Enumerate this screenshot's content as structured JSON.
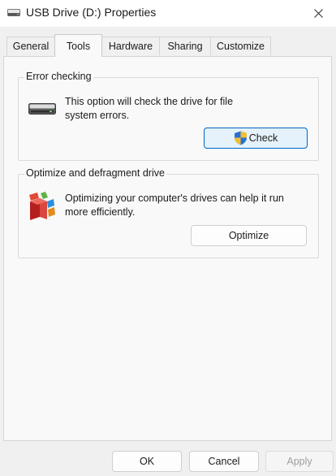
{
  "window": {
    "title": "USB Drive (D:) Properties"
  },
  "tabs": [
    {
      "label": "General"
    },
    {
      "label": "Tools",
      "active": true
    },
    {
      "label": "Hardware"
    },
    {
      "label": "Sharing"
    },
    {
      "label": "Customize"
    }
  ],
  "error_checking": {
    "title": "Error checking",
    "description_line1": "This option will check the drive for file",
    "description_line2": "system errors.",
    "button_label": "Check",
    "icon": "drive-icon"
  },
  "optimize": {
    "title": "Optimize and defragment drive",
    "description_line1": "Optimizing your computer's drives can help it run",
    "description_line2": "more efficiently.",
    "button_label": "Optimize",
    "icon": "defrag-icon"
  },
  "footer": {
    "ok_label": "OK",
    "cancel_label": "Cancel",
    "apply_label": "Apply"
  },
  "colors": {
    "accent": "#0067c0",
    "check_button_bg": "#e5f1fb"
  }
}
